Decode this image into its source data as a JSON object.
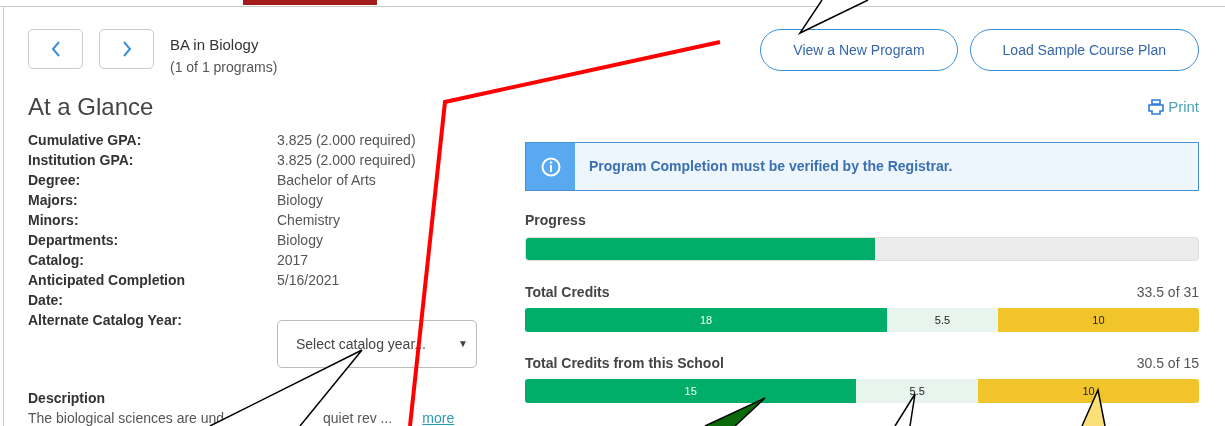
{
  "program": {
    "title": "BA in Biology",
    "subtitle": "(1 of 1 programs)"
  },
  "actions": [
    "View a New Program",
    "Load Sample Course Plan"
  ],
  "heading": "At a Glance",
  "print": "Print",
  "details": [
    {
      "label": "Cumulative GPA:",
      "value": "3.825 (2.000 required)"
    },
    {
      "label": "Institution GPA:",
      "value": "3.825 (2.000 required)"
    },
    {
      "label": "Degree:",
      "value": "Bachelor of Arts"
    },
    {
      "label": "Majors:",
      "value": "Biology"
    },
    {
      "label": "Minors:",
      "value": "Chemistry"
    },
    {
      "label": "Departments:",
      "value": "Biology"
    },
    {
      "label": "Catalog:",
      "value": "2017"
    },
    {
      "label": "Anticipated Completion Date:",
      "value": "5/16/2021"
    }
  ],
  "catalog_select": {
    "label": "Alternate Catalog Year:",
    "placeholder": "Select catalog year...",
    "arrow": "▼"
  },
  "description": {
    "title": "Description",
    "text_start": "The biological sciences are und",
    "text_end": "quiet rev ...",
    "link": "more"
  },
  "notice": "Program Completion must be verified by the Registrar.",
  "progress": {
    "label": "Progress",
    "level": 0.52
  },
  "credits": [
    {
      "label": "Total Credits",
      "total": "33.5 of 31",
      "segments": [
        {
          "kind": "done",
          "value": "18"
        },
        {
          "kind": "current",
          "value": "5.5"
        },
        {
          "kind": "planned",
          "value": "10"
        }
      ]
    },
    {
      "label": "Total Credits from this School",
      "total": "30.5 of 15",
      "segments": [
        {
          "kind": "done",
          "value": "15"
        },
        {
          "kind": "current",
          "value": "5.5"
        },
        {
          "kind": "planned",
          "value": "10"
        }
      ]
    }
  ]
}
